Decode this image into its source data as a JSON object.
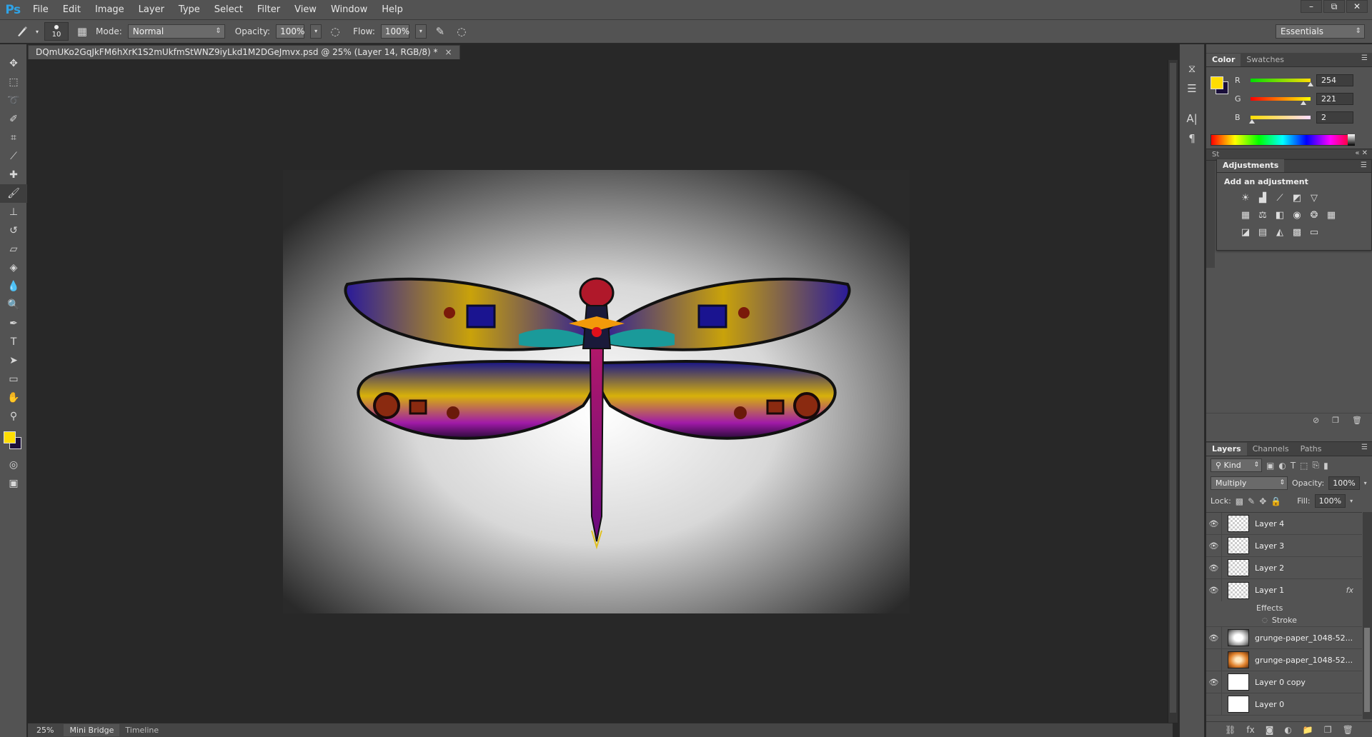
{
  "app": {
    "logo": "Ps",
    "menu": [
      "File",
      "Edit",
      "Image",
      "Layer",
      "Type",
      "Select",
      "Filter",
      "View",
      "Window",
      "Help"
    ],
    "window_controls": [
      "–",
      "⧉",
      "✕"
    ]
  },
  "options_bar": {
    "brush_size": "10",
    "mode_label": "Mode:",
    "mode_value": "Normal",
    "opacity_label": "Opacity:",
    "opacity_value": "100%",
    "flow_label": "Flow:",
    "flow_value": "100%",
    "workspace": "Essentials"
  },
  "document": {
    "tab_title": "DQmUKo2GqJkFM6hXrK1S2mUkfmStWNZ9iyLkd1M2DGeJmvx.psd @ 25% (Layer 14, RGB/8) *",
    "tab_close": "×",
    "zoom": "25%"
  },
  "status": {
    "tabs": [
      "Mini Bridge",
      "Timeline"
    ]
  },
  "color_panel": {
    "tabs": [
      "Color",
      "Swatches"
    ],
    "foreground": "#fedd02",
    "background": "#1a0f3a",
    "r_label": "R",
    "r_value": "254",
    "g_label": "G",
    "g_value": "221",
    "b_label": "B",
    "b_value": "2"
  },
  "adjustments_panel": {
    "side_tab": "St",
    "tab": "Adjustments",
    "title": "Add an adjustment",
    "icons": [
      "brightness-contrast-icon",
      "levels-icon",
      "curves-icon",
      "exposure-icon",
      "vibrance-icon",
      "hue-saturation-icon",
      "color-balance-icon",
      "black-white-icon",
      "photo-filter-icon",
      "channel-mixer-icon",
      "color-lookup-icon",
      "invert-icon",
      "posterize-icon",
      "threshold-icon",
      "selective-color-icon",
      "gradient-map-icon"
    ]
  },
  "layers_panel": {
    "tabs": [
      "Layers",
      "Channels",
      "Paths"
    ],
    "kind_label": "Kind",
    "blend_mode": "Multiply",
    "opacity_label": "Opacity:",
    "opacity_value": "100%",
    "lock_label": "Lock:",
    "fill_label": "Fill:",
    "fill_value": "100%",
    "layers": [
      {
        "name": "Layer 4",
        "visible": true,
        "thumb": "checker"
      },
      {
        "name": "Layer 3",
        "visible": true,
        "thumb": "checker"
      },
      {
        "name": "Layer 2",
        "visible": true,
        "thumb": "checker"
      },
      {
        "name": "Layer 1",
        "visible": true,
        "thumb": "checker",
        "fx": "fx"
      },
      {
        "name": "grunge-paper_1048-52...",
        "visible": true,
        "thumb": "grunge1"
      },
      {
        "name": "grunge-paper_1048-52...",
        "visible": false,
        "thumb": "grunge2"
      },
      {
        "name": "Layer 0 copy",
        "visible": true,
        "thumb": "white"
      },
      {
        "name": "Layer 0",
        "visible": false,
        "thumb": "white"
      }
    ],
    "effects_label": "Effects",
    "stroke_label": "Stroke"
  }
}
